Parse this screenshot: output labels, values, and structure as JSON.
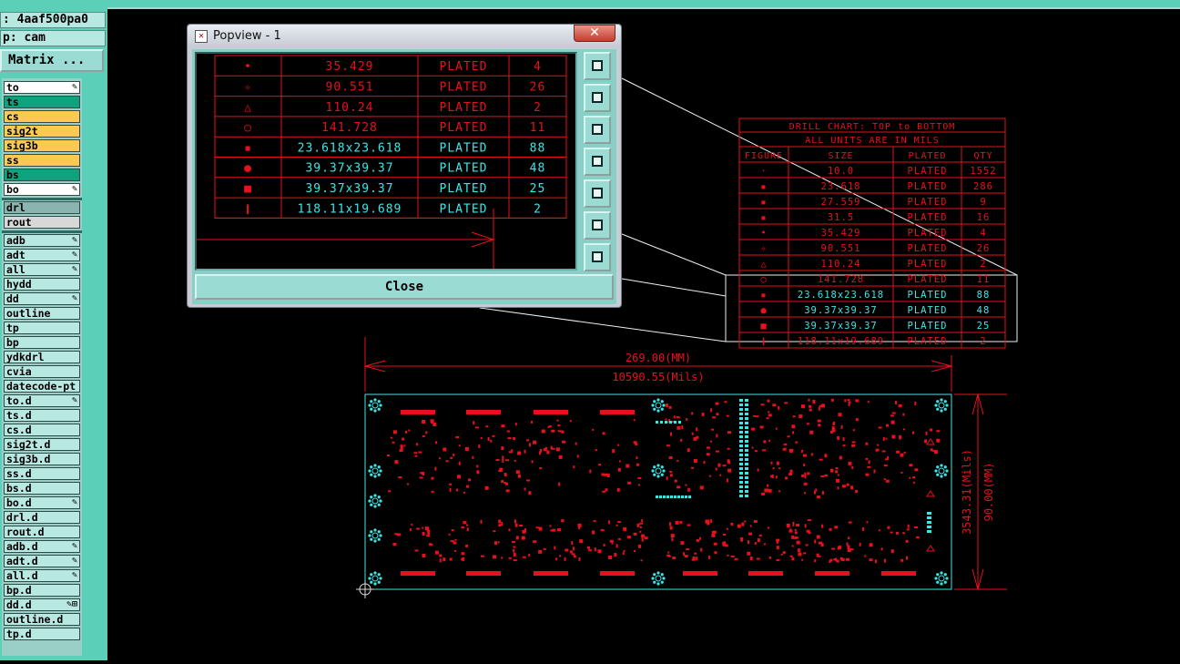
{
  "header": {
    "job_line": ": 4aaf500pa0",
    "step_line": "p: cam",
    "matrix_button": "Matrix ..."
  },
  "layers": [
    {
      "name": "to",
      "color": "#ffffff",
      "mark": "✎"
    },
    {
      "name": "ts",
      "color": "#0ea27e",
      "mark": ""
    },
    {
      "name": "cs",
      "color": "#ffc850",
      "mark": ""
    },
    {
      "name": "sig2t",
      "color": "#ffc850",
      "mark": ""
    },
    {
      "name": "sig3b",
      "color": "#ffc850",
      "mark": ""
    },
    {
      "name": "ss",
      "color": "#ffc850",
      "mark": ""
    },
    {
      "name": "bs",
      "color": "#0ea27e",
      "mark": ""
    },
    {
      "name": "bo",
      "color": "#ffffff",
      "mark": "✎"
    },
    {
      "name": "drl",
      "color": "#8ab4b0",
      "mark": ""
    },
    {
      "name": "rout",
      "color": "#d8d8d8",
      "mark": ""
    },
    {
      "name": "adb",
      "color": "#b8e8e2",
      "mark": "✎"
    },
    {
      "name": "adt",
      "color": "#b8e8e2",
      "mark": "✎"
    },
    {
      "name": "all",
      "color": "#b8e8e2",
      "mark": "✎"
    },
    {
      "name": "hydd",
      "color": "#b8e8e2",
      "mark": ""
    },
    {
      "name": "dd",
      "color": "#b8e8e2",
      "mark": "✎"
    },
    {
      "name": "outline",
      "color": "#b8e8e2",
      "mark": ""
    },
    {
      "name": "tp",
      "color": "#b8e8e2",
      "mark": ""
    },
    {
      "name": "bp",
      "color": "#b8e8e2",
      "mark": ""
    },
    {
      "name": "ydkdrl",
      "color": "#b8e8e2",
      "mark": ""
    },
    {
      "name": "cvia",
      "color": "#b8e8e2",
      "mark": ""
    },
    {
      "name": "datecode-pt",
      "color": "#b8e8e2",
      "mark": ""
    },
    {
      "name": "to.d",
      "color": "#b8e8e2",
      "mark": "✎"
    },
    {
      "name": "ts.d",
      "color": "#b8e8e2",
      "mark": ""
    },
    {
      "name": "cs.d",
      "color": "#b8e8e2",
      "mark": ""
    },
    {
      "name": "sig2t.d",
      "color": "#b8e8e2",
      "mark": ""
    },
    {
      "name": "sig3b.d",
      "color": "#b8e8e2",
      "mark": ""
    },
    {
      "name": "ss.d",
      "color": "#b8e8e2",
      "mark": ""
    },
    {
      "name": "bs.d",
      "color": "#b8e8e2",
      "mark": ""
    },
    {
      "name": "bo.d",
      "color": "#b8e8e2",
      "mark": "✎"
    },
    {
      "name": "drl.d",
      "color": "#b8e8e2",
      "mark": ""
    },
    {
      "name": "rout.d",
      "color": "#b8e8e2",
      "mark": ""
    },
    {
      "name": "adb.d",
      "color": "#b8e8e2",
      "mark": "✎"
    },
    {
      "name": "adt.d",
      "color": "#b8e8e2",
      "mark": "✎"
    },
    {
      "name": "all.d",
      "color": "#b8e8e2",
      "mark": "✎"
    },
    {
      "name": "bp.d",
      "color": "#b8e8e2",
      "mark": ""
    },
    {
      "name": "dd.d",
      "color": "#b8e8e2",
      "mark": "✎⊞"
    },
    {
      "name": "outline.d",
      "color": "#b8e8e2",
      "mark": ""
    },
    {
      "name": "tp.d",
      "color": "#b8e8e2",
      "mark": ""
    }
  ],
  "popup": {
    "title": "Popview - 1",
    "close_x": "✕",
    "close_label": "Close",
    "tools": [
      "zoom-fit-icon",
      "move-up-icon",
      "move-down-icon",
      "move-left-icon",
      "move-right-icon",
      "zoom-in-icon",
      "zoom-out-icon"
    ],
    "rows": [
      {
        "sym": "•",
        "size": "35.429",
        "plated": "PLATED",
        "qty": "4"
      },
      {
        "sym": "✧",
        "size": "90.551",
        "plated": "PLATED",
        "qty": "26"
      },
      {
        "sym": "△",
        "size": "110.24",
        "plated": "PLATED",
        "qty": "2"
      },
      {
        "sym": "○",
        "size": "141.728",
        "plated": "PLATED",
        "qty": "11"
      },
      {
        "sym": "▪",
        "size": "23.618x23.618",
        "plated": "PLATED",
        "qty": "88"
      },
      {
        "sym": "●",
        "size": "39.37x39.37",
        "plated": "PLATED",
        "qty": "48"
      },
      {
        "sym": "■",
        "size": "39.37x39.37",
        "plated": "PLATED",
        "qty": "25"
      },
      {
        "sym": "❙",
        "size": "118.11x19.689",
        "plated": "PLATED",
        "qty": "2"
      }
    ]
  },
  "drill_chart": {
    "title": "DRILL CHART: TOP to BOTTOM",
    "units": "ALL UNITS ARE IN MILS",
    "headers": [
      "FIGURE",
      "SIZE",
      "PLATED",
      "QTY"
    ],
    "rows": [
      {
        "sym": "·",
        "size": "10.0",
        "plated": "PLATED",
        "qty": "1552"
      },
      {
        "sym": "▪",
        "size": "23.618",
        "plated": "PLATED",
        "qty": "286"
      },
      {
        "sym": "▪",
        "size": "27.559",
        "plated": "PLATED",
        "qty": "9"
      },
      {
        "sym": "▪",
        "size": "31.5",
        "plated": "PLATED",
        "qty": "16"
      },
      {
        "sym": "•",
        "size": "35.429",
        "plated": "PLATED",
        "qty": "4"
      },
      {
        "sym": "✧",
        "size": "90.551",
        "plated": "PLATED",
        "qty": "26"
      },
      {
        "sym": "△",
        "size": "110.24",
        "plated": "PLATED",
        "qty": "2"
      },
      {
        "sym": "○",
        "size": "141.728",
        "plated": "PLATED",
        "qty": "11"
      },
      {
        "sym": "▪",
        "size": "23.618x23.618",
        "plated": "PLATED",
        "qty": "88"
      },
      {
        "sym": "●",
        "size": "39.37x39.37",
        "plated": "PLATED",
        "qty": "48"
      },
      {
        "sym": "■",
        "size": "39.37x39.37",
        "plated": "PLATED",
        "qty": "25"
      },
      {
        "sym": "❙",
        "size": "118.11x19.689",
        "plated": "PLATED",
        "qty": "2"
      }
    ]
  },
  "dimensions": {
    "width_mm": "269.00(MM)",
    "width_mils": "10590.55(Mils)",
    "height_mils": "3543.31(Mils)",
    "height_mm": "90.00(MM)"
  },
  "colors": {
    "accent_red": "#e8101c",
    "cyan": "#3ce6e6",
    "panel": "#5ccfb8"
  }
}
